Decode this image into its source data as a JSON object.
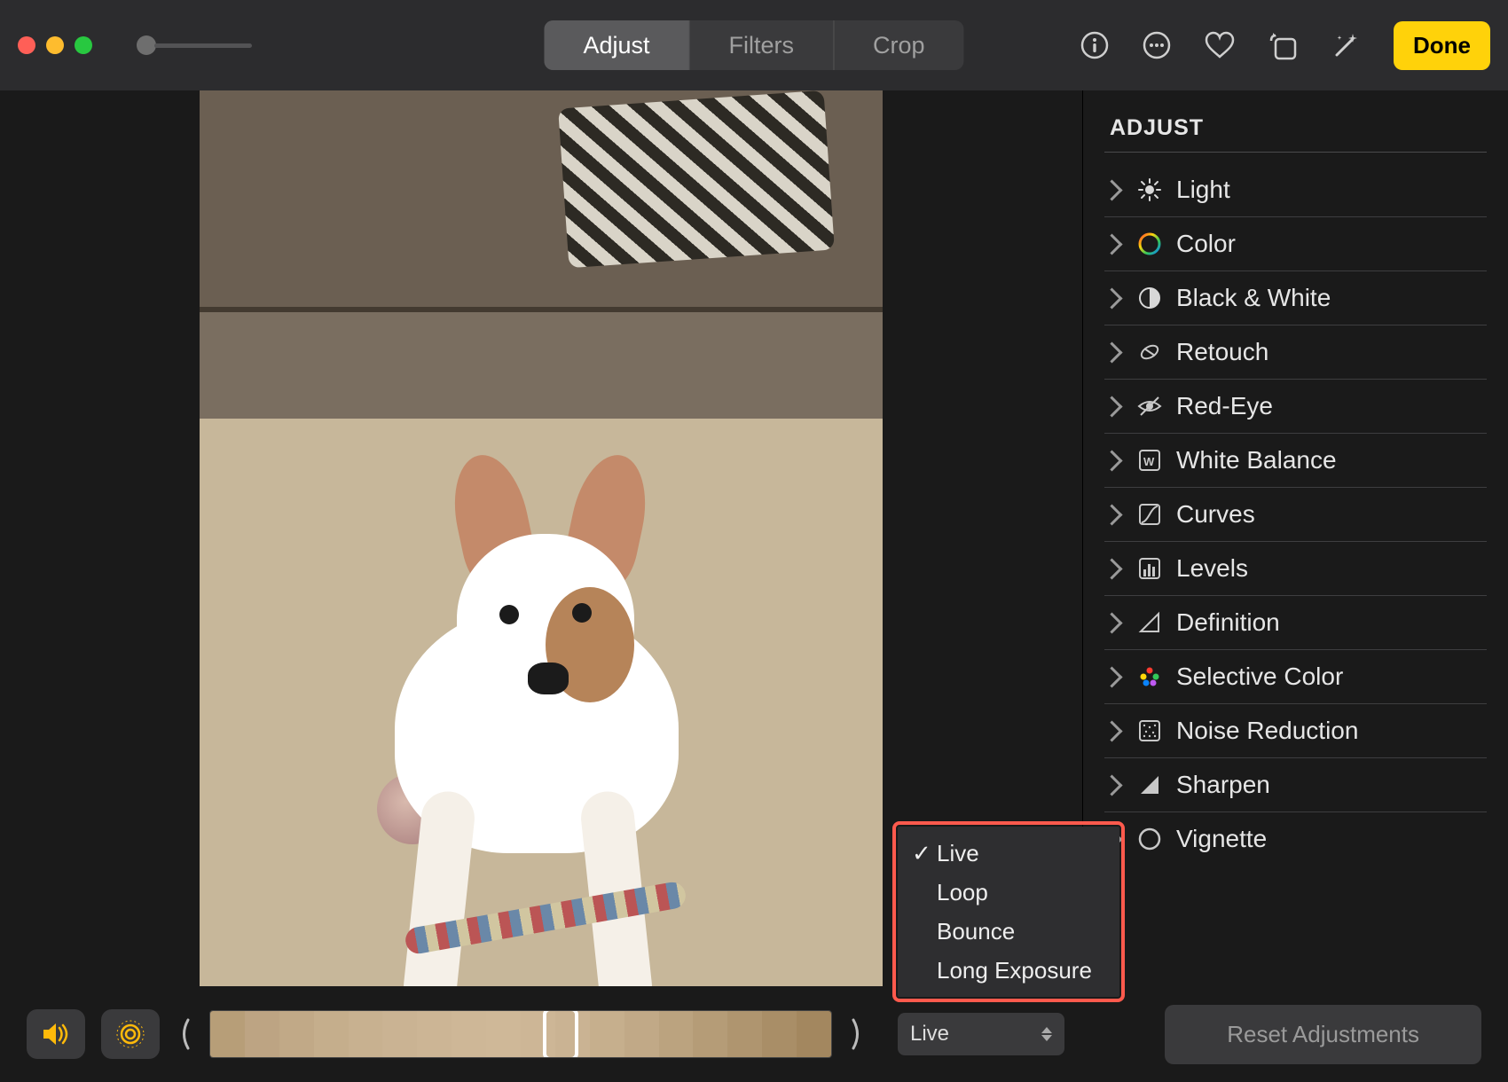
{
  "toolbar": {
    "segments": [
      "Adjust",
      "Filters",
      "Crop"
    ],
    "active_segment": 0,
    "done_label": "Done"
  },
  "sidebar": {
    "title": "ADJUST",
    "items": [
      {
        "icon": "light-icon",
        "label": "Light"
      },
      {
        "icon": "color-icon",
        "label": "Color"
      },
      {
        "icon": "bw-icon",
        "label": "Black & White"
      },
      {
        "icon": "retouch-icon",
        "label": "Retouch"
      },
      {
        "icon": "redeye-icon",
        "label": "Red-Eye"
      },
      {
        "icon": "whitebalance-icon",
        "label": "White Balance"
      },
      {
        "icon": "curves-icon",
        "label": "Curves"
      },
      {
        "icon": "levels-icon",
        "label": "Levels"
      },
      {
        "icon": "definition-icon",
        "label": "Definition"
      },
      {
        "icon": "selectivecolor-icon",
        "label": "Selective Color"
      },
      {
        "icon": "noisereduction-icon",
        "label": "Noise Reduction"
      },
      {
        "icon": "sharpen-icon",
        "label": "Sharpen"
      },
      {
        "icon": "vignette-icon",
        "label": "Vignette"
      }
    ],
    "reset_label": "Reset Adjustments"
  },
  "live_photo": {
    "selected": "Live",
    "options": [
      "Live",
      "Loop",
      "Bounce",
      "Long Exposure"
    ]
  },
  "filmstrip": {
    "frame_count": 18,
    "selected_index": 9
  },
  "colors": {
    "accent": "#ffd20a",
    "highlight_outline": "#ff5a4d",
    "frame_tones": [
      "#b79e78",
      "#bda483",
      "#c1a987",
      "#c5ae8c",
      "#c8b190",
      "#cab393",
      "#ccb595",
      "#ceb797",
      "#cfb898",
      "#cdb696",
      "#cab393",
      "#c6af8d",
      "#c1a987",
      "#bba37f",
      "#b59c77",
      "#af956f",
      "#a98e67",
      "#a3875f"
    ]
  }
}
